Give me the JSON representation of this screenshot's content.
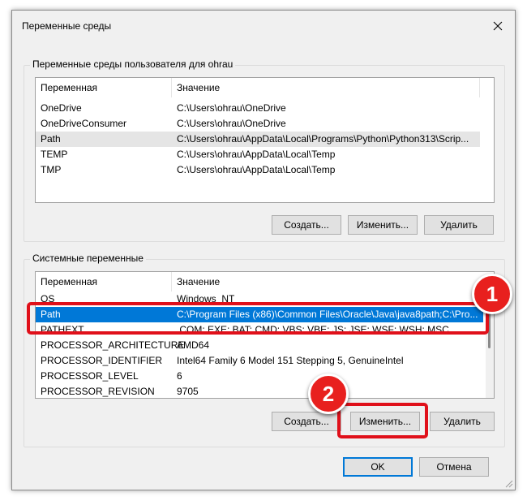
{
  "window": {
    "title": "Переменные среды"
  },
  "user_vars": {
    "group_label": "Переменные среды пользователя для ohrau",
    "col_name": "Переменная",
    "col_value": "Значение",
    "rows": [
      {
        "name": "OneDrive",
        "value": "C:\\Users\\ohrau\\OneDrive"
      },
      {
        "name": "OneDriveConsumer",
        "value": "C:\\Users\\ohrau\\OneDrive"
      },
      {
        "name": "Path",
        "value": "C:\\Users\\ohrau\\AppData\\Local\\Programs\\Python\\Python313\\Scrip..."
      },
      {
        "name": "TEMP",
        "value": "C:\\Users\\ohrau\\AppData\\Local\\Temp"
      },
      {
        "name": "TMP",
        "value": "C:\\Users\\ohrau\\AppData\\Local\\Temp"
      }
    ],
    "create_label": "Создать...",
    "edit_label": "Изменить...",
    "delete_label": "Удалить"
  },
  "system_vars": {
    "group_label": "Системные переменные",
    "col_name": "Переменная",
    "col_value": "Значение",
    "rows": [
      {
        "name": "OS",
        "value": "Windows_NT"
      },
      {
        "name": "Path",
        "value": "C:\\Program Files (x86)\\Common Files\\Oracle\\Java\\java8path;C:\\Pro..."
      },
      {
        "name": "PATHEXT",
        "value": ".COM;.EXE;.BAT;.CMD;.VBS;.VBE;.JS;.JSE;.WSF;.WSH;.MSC"
      },
      {
        "name": "PROCESSOR_ARCHITECTURE",
        "value": "AMD64"
      },
      {
        "name": "PROCESSOR_IDENTIFIER",
        "value": "Intel64 Family 6 Model 151 Stepping 5, GenuineIntel"
      },
      {
        "name": "PROCESSOR_LEVEL",
        "value": "6"
      },
      {
        "name": "PROCESSOR_REVISION",
        "value": "9705"
      }
    ],
    "create_label": "Создать...",
    "edit_label": "Изменить...",
    "delete_label": "Удалить"
  },
  "footer": {
    "ok_label": "OK",
    "cancel_label": "Отмена"
  },
  "annotations": {
    "badge_1": "1",
    "badge_2": "2",
    "color": "#e0101a"
  },
  "colors": {
    "selection": "#0078d7",
    "window_bg": "#f0f0f0"
  }
}
